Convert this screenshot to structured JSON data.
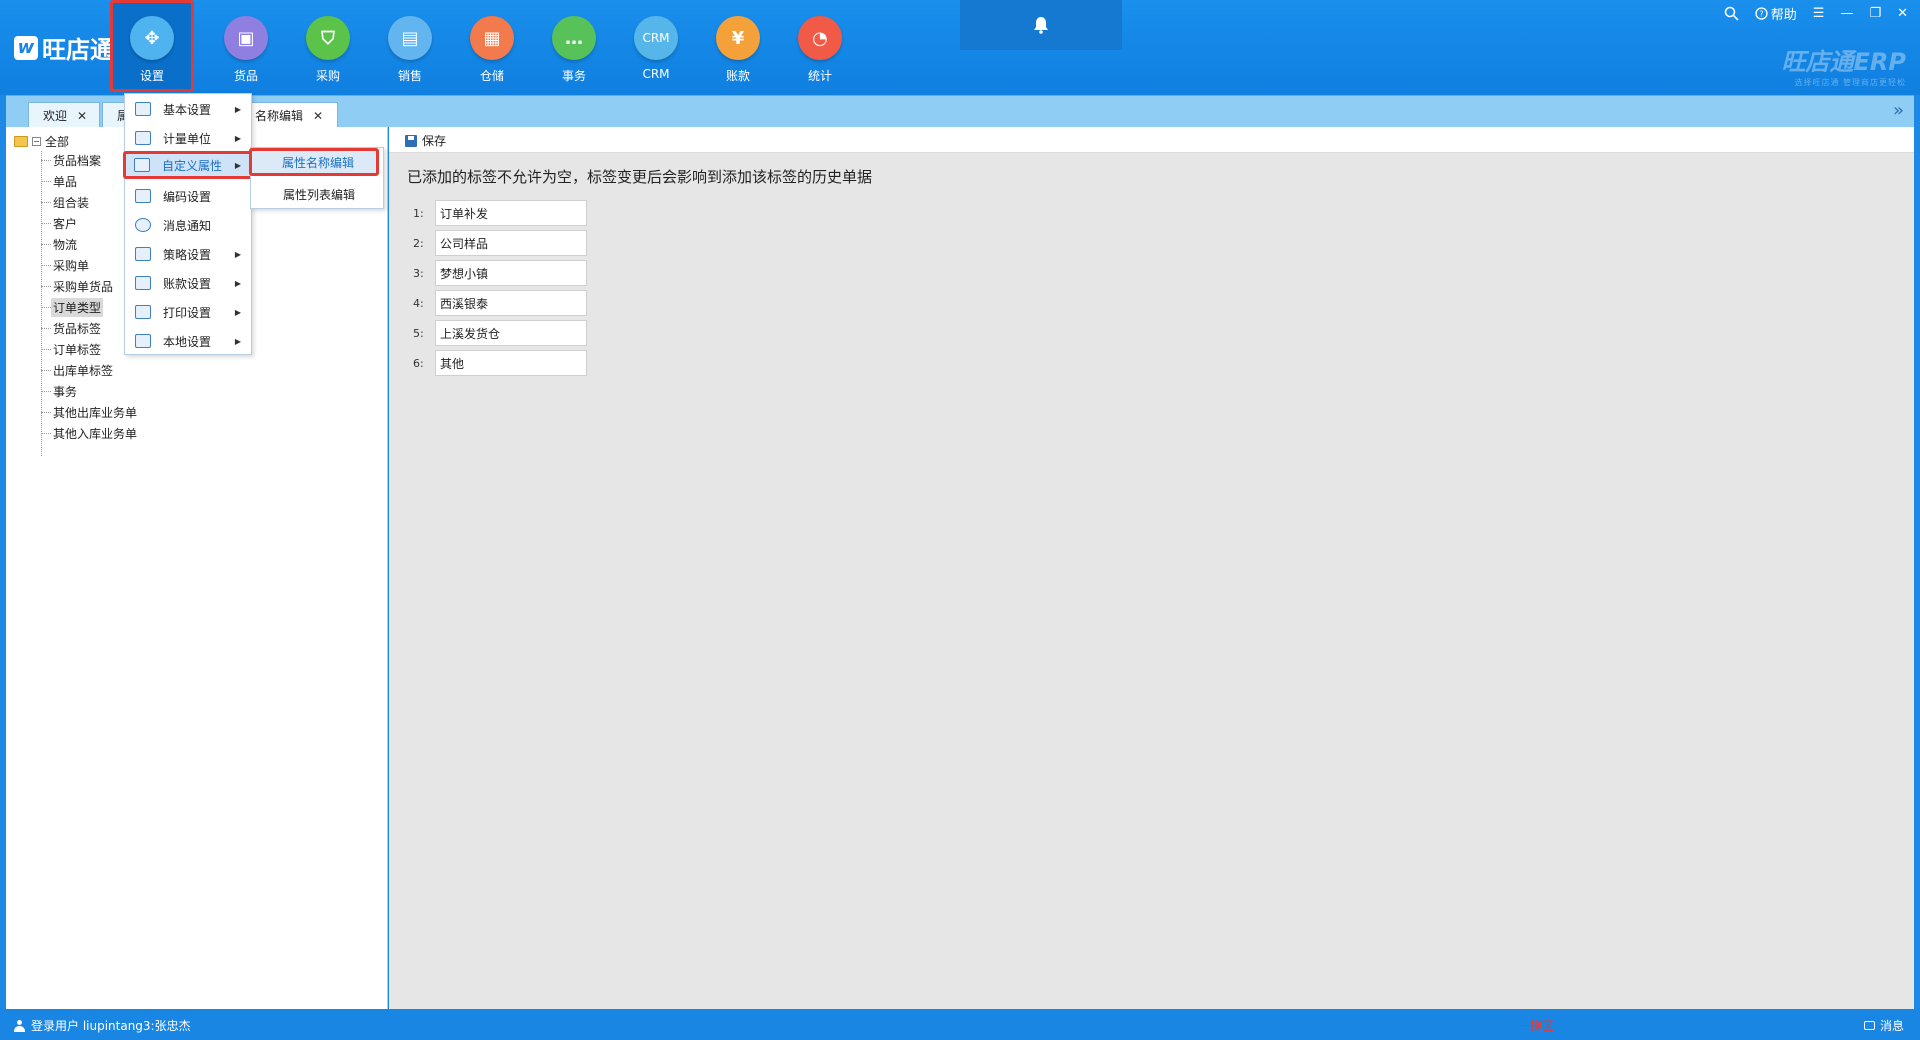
{
  "app": {
    "logo_text": "旺店通",
    "logo_mark": "w",
    "brand_watermark": "旺店通ERP",
    "brand_slogan": "选择旺店通 管理商店更轻松"
  },
  "modules": [
    {
      "label": "设置",
      "icon": "settings-icon",
      "color": "#4fb3ef",
      "glyph": "✥"
    },
    {
      "label": "货品",
      "icon": "goods-icon",
      "color": "#8f7fe0",
      "glyph": "▣"
    },
    {
      "label": "采购",
      "icon": "purchase-icon",
      "color": "#5bc24a",
      "glyph": "⛉"
    },
    {
      "label": "销售",
      "icon": "sales-icon",
      "color": "#63b5ef",
      "glyph": "▤"
    },
    {
      "label": "仓储",
      "icon": "warehouse-icon",
      "color": "#f27a4c",
      "glyph": "▦"
    },
    {
      "label": "事务",
      "icon": "affairs-icon",
      "color": "#57c25a",
      "glyph": "…"
    },
    {
      "label": "CRM",
      "icon": "crm-icon",
      "color": "#56b6ea",
      "glyph": "CRM"
    },
    {
      "label": "账款",
      "icon": "account-icon",
      "color": "#f5a13a",
      "glyph": "¥"
    },
    {
      "label": "统计",
      "icon": "statistics-icon",
      "color": "#f15a46",
      "glyph": "◔"
    }
  ],
  "window": {
    "help_label": "帮助",
    "search_icon": "search-icon",
    "menu_icon": "menu-icon",
    "minimize_icon": "minimize-icon",
    "restore_icon": "restore-icon",
    "close_icon": "close-icon",
    "bell_icon": "bell-icon"
  },
  "tabs": [
    {
      "label": "欢迎"
    },
    {
      "label": "属"
    },
    {
      "label": "名称编辑"
    }
  ],
  "tree": {
    "root": "全部",
    "items": [
      "货品档案",
      "单品",
      "组合装",
      "客户",
      "物流",
      "采购单",
      "采购单货品",
      "订单类型",
      "货品标签",
      "订单标签",
      "出库单标签",
      "事务",
      "其他出库业务单",
      "其他入库业务单"
    ],
    "selected": "订单类型"
  },
  "menu": {
    "items": [
      {
        "label": "基本设置",
        "has_sub": true
      },
      {
        "label": "计量单位",
        "has_sub": true
      },
      {
        "label": "自定义属性",
        "has_sub": true
      },
      {
        "label": "编码设置",
        "has_sub": false
      },
      {
        "label": "消息通知",
        "has_sub": false
      },
      {
        "label": "策略设置",
        "has_sub": true
      },
      {
        "label": "账款设置",
        "has_sub": true
      },
      {
        "label": "打印设置",
        "has_sub": true
      },
      {
        "label": "本地设置",
        "has_sub": true
      }
    ],
    "highlighted": "自定义属性",
    "submenu": [
      "属性名称编辑",
      "属性列表编辑"
    ],
    "submenu_highlighted": "属性名称编辑"
  },
  "toolbar": {
    "save_label": "保存"
  },
  "notice": "已添加的标签不允许为空，标签变更后会影响到添加该标签的历史单据",
  "tag_fields": [
    {
      "num": "1:",
      "value": "订单补发"
    },
    {
      "num": "2:",
      "value": "公司样品"
    },
    {
      "num": "3:",
      "value": "梦想小镇"
    },
    {
      "num": "4:",
      "value": "西溪银泰"
    },
    {
      "num": "5:",
      "value": "上溪发货仓"
    },
    {
      "num": "6:",
      "value": "其他"
    }
  ],
  "status": {
    "user_label": "登录用户 liupintang3:张忠杰",
    "region": "一梯区",
    "message_label": "消息"
  },
  "colors": {
    "header_blue": "#1a8fec",
    "highlight_red": "#e53935",
    "tab_bar": "#8fcdf5"
  }
}
